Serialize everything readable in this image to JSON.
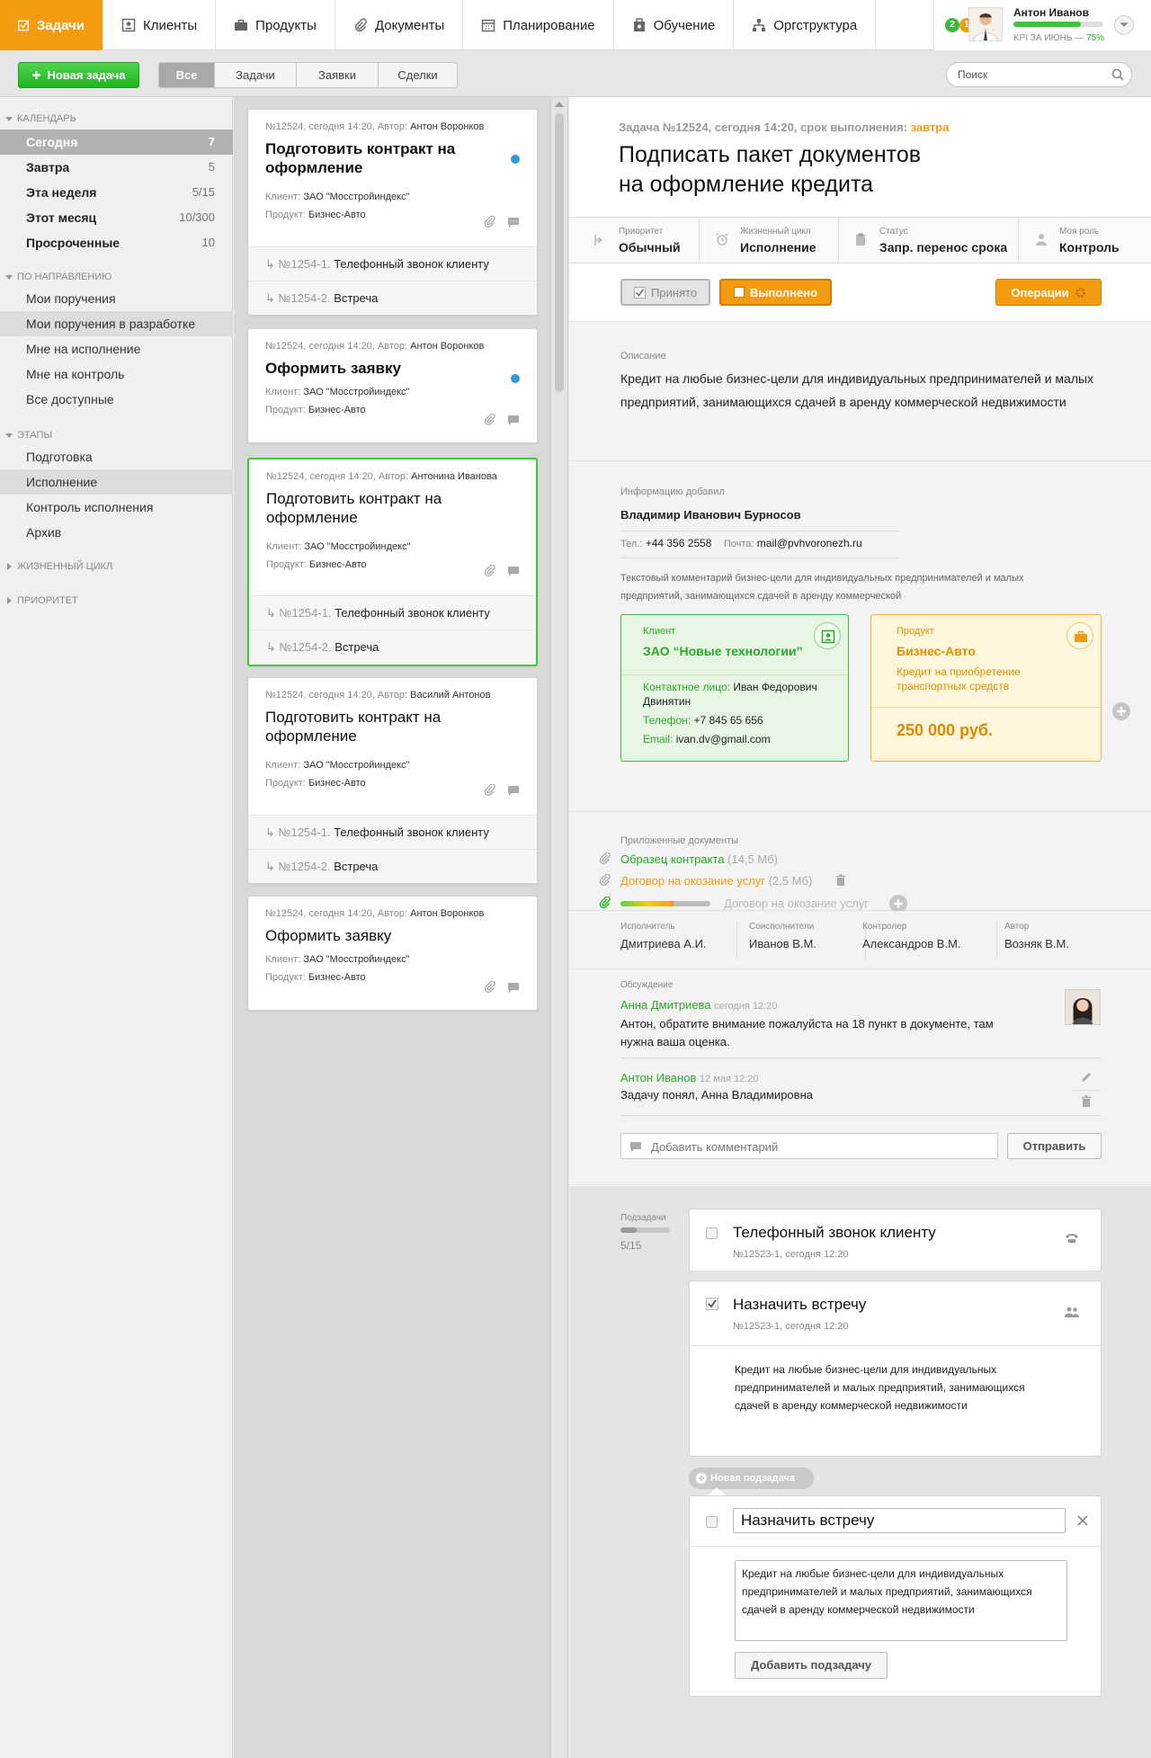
{
  "nav": {
    "items": [
      {
        "label": "Задачи"
      },
      {
        "label": "Клиенты"
      },
      {
        "label": "Продукты"
      },
      {
        "label": "Документы"
      },
      {
        "label": "Планирование"
      },
      {
        "label": "Обучение"
      },
      {
        "label": "Оргструктура"
      }
    ],
    "user": {
      "name": "Антон Иванов",
      "kpi_label": "KPI ЗА ИЮНЬ — ",
      "kpi_value": "75%",
      "kpi_fraction": 0.75,
      "badge_green": "2",
      "badge_orange": "1"
    }
  },
  "toolbar": {
    "new_task": "Новая задача",
    "filters": [
      "Все",
      "Задачи",
      "Заявки",
      "Сделки"
    ],
    "search_placeholder": "Поиск"
  },
  "sidebar": {
    "calendar": {
      "title": "Календарь",
      "items": [
        {
          "label": "Сегодня",
          "count": "7"
        },
        {
          "label": "Завтра",
          "count": "5"
        },
        {
          "label": "Эта неделя",
          "count": "5/15"
        },
        {
          "label": "Этот месяц",
          "count": "10/300"
        },
        {
          "label": "Просроченные",
          "count": "10"
        }
      ]
    },
    "direction": {
      "title": "По направлению",
      "items": [
        {
          "label": "Мои поручения"
        },
        {
          "label": "Мои поручения в разработке"
        },
        {
          "label": "Мне на исполнение"
        },
        {
          "label": "Мне на контроль"
        },
        {
          "label": "Все доступные"
        }
      ]
    },
    "stages": {
      "title": "Этапы",
      "items": [
        {
          "label": "Подготовка"
        },
        {
          "label": "Исполнение"
        },
        {
          "label": "Контроль исполнения"
        },
        {
          "label": "Архив"
        }
      ]
    },
    "lifecycle": "Жизненный цикл",
    "priority": "Приоритет"
  },
  "list": {
    "cards": [
      {
        "meta": "№12524, сегодня 14:20, Автор:",
        "author": "Антон Воронков",
        "title": "Подготовить контракт на оформление",
        "client_label": "Клиент:",
        "client": "ЗАО \"Мосстройиндекс\"",
        "product_label": "Продукт:",
        "product": "Бизнес-Авто",
        "subs": [
          {
            "num": "№1254-1.",
            "text": "Телефонный звонок клиенту"
          },
          {
            "num": "№1254-2.",
            "text": "Встреча"
          }
        ]
      },
      {
        "meta": "№12524, сегодня 14:20, Автор:",
        "author": "Антон Воронков",
        "title": "Оформить заявку",
        "client_label": "Клиент:",
        "client": "ЗАО \"Мосстройиндекс\"",
        "product_label": "Продукт:",
        "product": "Бизнес-Авто"
      },
      {
        "meta": "№12524, сегодня 14:20, Автор:",
        "author": "Антонина Иванова",
        "title": "Подготовить контракт на оформление",
        "client_label": "Клиент:",
        "client": "ЗАО \"Мосстройиндекс\"",
        "product_label": "Продукт:",
        "product": "Бизнес-Авто",
        "subs": [
          {
            "num": "№1254-1.",
            "text": "Телефонный звонок клиенту"
          },
          {
            "num": "№1254-2.",
            "text": "Встреча"
          }
        ]
      },
      {
        "meta": "№12524, сегодня 14:20, Автор:",
        "author": "Василий Антонов",
        "title": "Подготовить контракт на оформление",
        "client_label": "Клиент:",
        "client": "ЗАО \"Мосстройиндекс\"",
        "product_label": "Продукт:",
        "product": "Бизнес-Авто",
        "subs": [
          {
            "num": "№1254-1.",
            "text": "Телефонный звонок клиенту"
          },
          {
            "num": "№1254-2.",
            "text": "Встреча"
          }
        ]
      },
      {
        "meta": "№12524, сегодня 14:20, Автор:",
        "author": "Антон Воронков",
        "title": "Оформить заявку",
        "client_label": "Клиент:",
        "client": "ЗАО \"Мосстройиндекс\"",
        "product_label": "Продукт:",
        "product": "Бизнес-Авто"
      }
    ]
  },
  "detail": {
    "header_meta": "Задача №12524, сегодня 14:20, срок выполнения:",
    "deadline": "завтра",
    "title_line1": "Подписать пакет документов",
    "title_line2": "на оформление кредита",
    "props": [
      {
        "label": "Приоритет",
        "value": "Обычный"
      },
      {
        "label": "Жизненный цикл",
        "value": "Исполнение"
      },
      {
        "label": "Статус",
        "value": "Запр. перенос срока"
      },
      {
        "label": "Моя роль",
        "value": "Контроль"
      }
    ],
    "btn_accepted": "Принято",
    "btn_done": "Выполнено",
    "btn_operations": "Операции",
    "description_label": "Описание",
    "description": "Кредит на любые бизнес-цели для индивидуальных предпринимателей и малых предприятий, занимающихся сдачей в аренду коммерческой недвижимости",
    "added_label": "Информацию добавил",
    "added_name": "Владимир Иванович Бурносов",
    "phone_label": "Тел.:",
    "phone": "+44 356 2558",
    "mail_label": "Почта:",
    "mail": "mail@pvhvoronezh.ru",
    "comment_text": "Текстовый комментарий бизнес-цели для индивидуальных предпринимателей и малых предприятий, занимающихся сдачей в аренду коммерческой",
    "client_card": {
      "label": "Клиент",
      "name": "ЗАО “Новые технологии”",
      "contact_label": "Контактное лицо:",
      "contact": "Иван Федорович Двинятин",
      "phone_label": "Телефон:",
      "phone": "+7 845 65 656",
      "email_label": "Email:",
      "email": "ivan.dv@gmail.com"
    },
    "product_card": {
      "label": "Продукт",
      "name": "Бизнес-Авто",
      "desc": "Кредит на приобретение транспортных средств",
      "amount": "250 000 руб."
    },
    "docs_label": "Приложенные документы",
    "docs": [
      {
        "name": "Образец контракта",
        "size": "(14,5 Мб)"
      },
      {
        "name": "Договор на окозание услуг",
        "size": "(2,5 Мб)"
      },
      {
        "name": "Договор на окозание услуг",
        "progress": 0.6
      }
    ],
    "people": [
      {
        "label": "Исполнитель",
        "value": "Дмитриева А.И."
      },
      {
        "label": "Соисполнители",
        "value": "Иванов В.М."
      },
      {
        "label": "Контролер",
        "value": "Александров В.М."
      },
      {
        "label": "Автор",
        "value": "Возняк В.М."
      }
    ],
    "discussion_label": "Обсуждение",
    "comments": [
      {
        "author": "Анна Дмитриева",
        "time": "сегодня 12:20",
        "text": "Антон, обратите внимание пожалуйста на 18 пункт в документе, там нужна ваша оценка."
      },
      {
        "author": "Антон Иванов",
        "time": "12 мая 12:20",
        "text": "Задачу понял, Анна Владимировна"
      }
    ],
    "comment_placeholder": "Добавить комментарий",
    "send": "Отправить",
    "subtasks_label": "Подзадачи",
    "subtasks_count": "5/15",
    "subtasks_progress": 0.33,
    "subtasks": [
      {
        "title": "Телефонный звонок клиенту",
        "meta": "№12523-1, сегодня 12:20"
      },
      {
        "title": "Назначить встречу",
        "meta": "№12523-1, сегодня 12:20",
        "desc": "Кредит на любые бизнес-цели для индивидуальных предпринимателей и малых предприятий, занимающихся сдачей в аренду коммерческой недвижимости"
      }
    ],
    "new_subtask": "Новая подзадача",
    "edit_title": "Назначить встречу",
    "edit_desc": "Кредит на любые бизнес-цели для индивидуальных предпринимателей и малых предприятий, занимающихся сдачей в аренду коммерческой недвижимости",
    "add_subtask": "Добавить подзадачу"
  }
}
